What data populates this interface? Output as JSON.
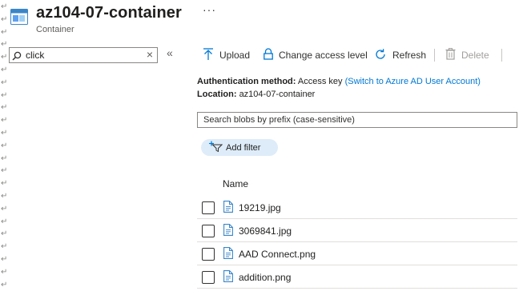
{
  "header": {
    "title": "az104-07-container",
    "subtitle": "Container",
    "more": "···"
  },
  "left": {
    "search_value": "click",
    "clear": "×",
    "collapse": "«"
  },
  "toolbar": {
    "upload": "Upload",
    "change_access": "Change access level",
    "refresh": "Refresh",
    "delete": "Delete"
  },
  "info": {
    "auth_label": "Authentication method:",
    "auth_value": "Access key",
    "auth_link": "(Switch to Azure AD User Account)",
    "location_label": "Location:",
    "location_value": "az104-07-container"
  },
  "search_prefix": {
    "placeholder": "Search blobs by prefix (case-sensitive)"
  },
  "filter": {
    "add_label": "Add filter"
  },
  "table": {
    "column_name": "Name",
    "rows": [
      {
        "name": "19219.jpg"
      },
      {
        "name": "3069841.jpg"
      },
      {
        "name": "AAD Connect.png"
      },
      {
        "name": "addition.png"
      }
    ]
  },
  "gutter_mark": "↵",
  "colors": {
    "accent": "#0078d4",
    "filter_bg": "#deecf9",
    "disabled": "#a19f9d"
  }
}
